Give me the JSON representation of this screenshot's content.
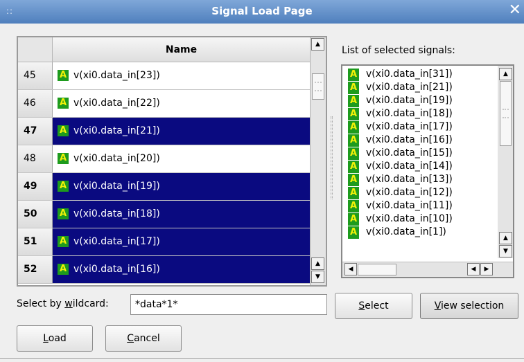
{
  "window": {
    "title": "Signal Load Page",
    "grip_glyph": "::",
    "close_glyph": "✕",
    "title_bar_color": "#5d8bc7"
  },
  "signal_table": {
    "column_header": "Name",
    "selection_color": "#0a0a80",
    "rows": [
      {
        "num": "45",
        "name": "v(xi0.data_in[23])",
        "selected": false
      },
      {
        "num": "46",
        "name": "v(xi0.data_in[22])",
        "selected": false
      },
      {
        "num": "47",
        "name": "v(xi0.data_in[21])",
        "selected": true
      },
      {
        "num": "48",
        "name": "v(xi0.data_in[20])",
        "selected": false
      },
      {
        "num": "49",
        "name": "v(xi0.data_in[19])",
        "selected": true
      },
      {
        "num": "50",
        "name": "v(xi0.data_in[18])",
        "selected": true
      },
      {
        "num": "51",
        "name": "v(xi0.data_in[17])",
        "selected": true
      },
      {
        "num": "52",
        "name": "v(xi0.data_in[16])",
        "selected": true
      }
    ]
  },
  "badge": {
    "letter": "A",
    "bg": "#1e9b1e",
    "fg": "#f1f108"
  },
  "selected_list": {
    "label": "List of selected signals:",
    "items": [
      "v(xi0.data_in[31])",
      "v(xi0.data_in[21])",
      "v(xi0.data_in[19])",
      "v(xi0.data_in[18])",
      "v(xi0.data_in[17])",
      "v(xi0.data_in[16])",
      "v(xi0.data_in[15])",
      "v(xi0.data_in[14])",
      "v(xi0.data_in[13])",
      "v(xi0.data_in[12])",
      "v(xi0.data_in[11])",
      "v(xi0.data_in[10])",
      "v(xi0.data_in[1])"
    ]
  },
  "wildcard": {
    "label_before": "Select by ",
    "label_underlined": "w",
    "label_after": "ildcard:",
    "value": "*data*1*"
  },
  "buttons": {
    "select": {
      "underlined": "S",
      "rest": "elect"
    },
    "view_selection": {
      "underlined": "V",
      "rest": "iew selection"
    },
    "load": {
      "underlined": "L",
      "rest": "oad"
    },
    "cancel": {
      "underlined": "C",
      "rest": "ancel"
    }
  },
  "icons": {
    "scroll_up": "▲",
    "scroll_down": "▼",
    "scroll_left": "◀",
    "scroll_right": "▶"
  }
}
